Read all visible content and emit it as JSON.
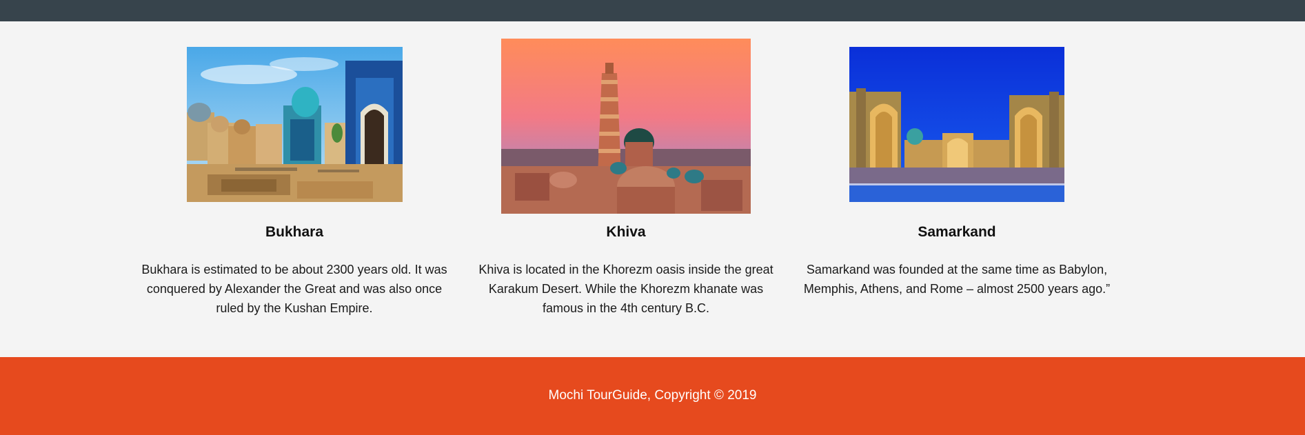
{
  "cities": [
    {
      "name": "Bukhara",
      "description": "Bukhara is estimated to be about 2300 years old. It was conquered by Alexander the Great and was also once ruled by the Kushan Empire.",
      "image_icon": "bukhara-mausoleum-image"
    },
    {
      "name": "Khiva",
      "description": "Khiva is located in the Khorezm oasis inside the great Karakum Desert. While the Khorezm khanate was famous in the 4th century B.C.",
      "image_icon": "khiva-minaret-image"
    },
    {
      "name": "Samarkand",
      "description": "Samarkand was founded at the same time as Babylon, Memphis, Athens, and Rome – almost 2500 years ago.”",
      "image_icon": "samarkand-registan-image"
    }
  ],
  "footer": {
    "copyright": "Mochi TourGuide, Copyright © 2019"
  },
  "colors": {
    "topbar": "#37444c",
    "content_bg": "#f4f4f4",
    "footer_bg": "#e64a1e",
    "footer_text": "#ffffff"
  }
}
